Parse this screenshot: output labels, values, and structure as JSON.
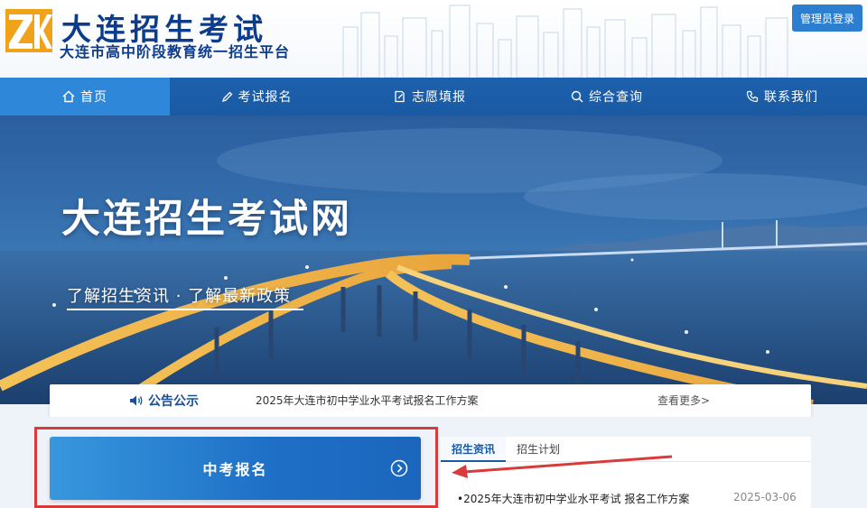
{
  "header": {
    "logo_letters": "ZK",
    "title": "大连招生考试",
    "subtitle": "大连市高中阶段教育统一招生平台",
    "admin_login": "管理员登录"
  },
  "nav": {
    "items": [
      {
        "label": "首页",
        "icon": "home-icon"
      },
      {
        "label": "考试报名",
        "icon": "pencil-icon"
      },
      {
        "label": "志愿填报",
        "icon": "edit-document-icon"
      },
      {
        "label": "综合查询",
        "icon": "search-icon"
      },
      {
        "label": "联系我们",
        "icon": "phone-icon"
      }
    ]
  },
  "banner": {
    "title": "大连招生考试网",
    "subtitle": "了解招生资讯  ·  了解最新政策"
  },
  "notice": {
    "label": "公告公示",
    "text": "2025年大连市初中学业水平考试报名工作方案",
    "more": "查看更多>"
  },
  "registration": {
    "button_label": "中考报名"
  },
  "info": {
    "tabs": [
      "招生资讯",
      "招生计划"
    ],
    "news": [
      {
        "title": "•2025年大连市初中学业水平考试 报名工作方案",
        "date": "2025-03-06"
      }
    ]
  },
  "colors": {
    "nav_bg": "#1a5aa4",
    "nav_active": "#2f87d9",
    "title_blue": "#0d3c8c",
    "highlight_red": "#d93a3a",
    "logo_orange": "#f0a21a"
  }
}
